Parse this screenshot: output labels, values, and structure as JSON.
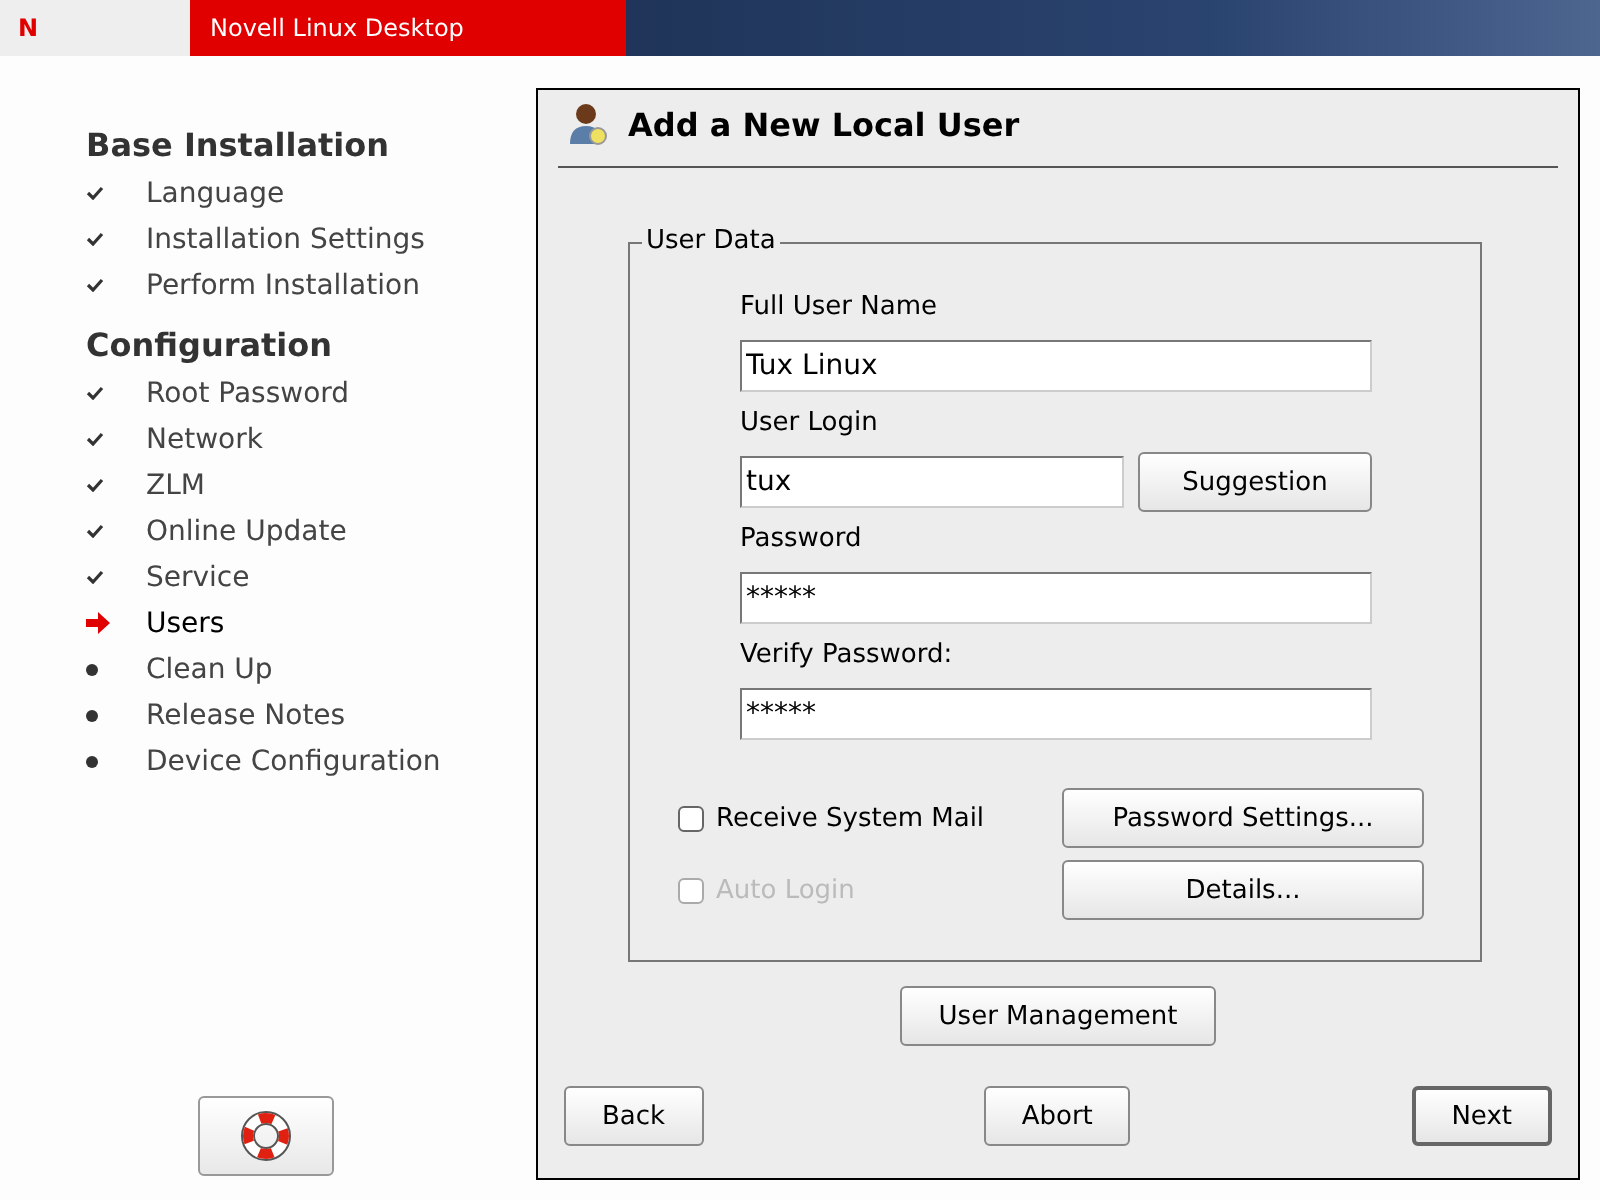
{
  "header": {
    "logo": "N",
    "title": "Novell Linux Desktop"
  },
  "sidebar": {
    "sections": [
      {
        "title": "Base Installation",
        "items": [
          {
            "label": "Language",
            "kind": "done"
          },
          {
            "label": "Installation Settings",
            "kind": "done"
          },
          {
            "label": "Perform Installation",
            "kind": "done"
          }
        ]
      },
      {
        "title": "Configuration",
        "items": [
          {
            "label": "Root Password",
            "kind": "done"
          },
          {
            "label": "Network",
            "kind": "done"
          },
          {
            "label": "ZLM",
            "kind": "done"
          },
          {
            "label": "Online Update",
            "kind": "done"
          },
          {
            "label": "Service",
            "kind": "done"
          },
          {
            "label": "Users",
            "kind": "current"
          },
          {
            "label": "Clean Up",
            "kind": "pending"
          },
          {
            "label": "Release Notes",
            "kind": "pending"
          },
          {
            "label": "Device Configuration",
            "kind": "pending"
          }
        ]
      }
    ]
  },
  "dialog": {
    "title": "Add a New Local User",
    "group": {
      "title": "User Data",
      "full_name": {
        "label": "Full User Name",
        "value": "Tux Linux"
      },
      "login": {
        "label": "User Login",
        "value": "tux",
        "button": "Suggestion"
      },
      "password": {
        "label": "Password",
        "value": "*****"
      },
      "verify": {
        "label": "Verify Password:",
        "value": "*****"
      },
      "options": [
        {
          "label": "Receive System Mail",
          "checked": false,
          "disabled": false,
          "button": "Password Settings..."
        },
        {
          "label": "Auto Login",
          "checked": false,
          "disabled": true,
          "button": "Details..."
        }
      ]
    },
    "management_button": "User Management",
    "buttons": [
      {
        "label": "Back",
        "default": false
      },
      {
        "label": "Abort",
        "default": false
      },
      {
        "label": "Next",
        "default": true
      }
    ]
  }
}
